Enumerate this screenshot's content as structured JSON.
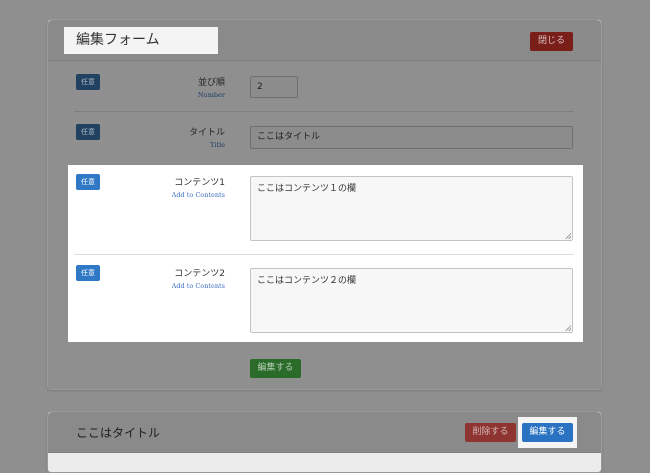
{
  "form": {
    "title": "編集フォーム",
    "close_label": "閉じる",
    "rows": [
      {
        "badge": "任意",
        "label": "並び順",
        "sublabel": "Number",
        "value": "2"
      },
      {
        "badge": "任意",
        "label": "タイトル",
        "sublabel": "Title",
        "value": "ここはタイトル"
      },
      {
        "badge": "任意",
        "label": "コンテンツ1",
        "sublabel": "Add to Contents",
        "value": "ここはコンテンツ１の欄"
      },
      {
        "badge": "任意",
        "label": "コンテンツ2",
        "sublabel": "Add to Contents",
        "value": "ここはコンテンツ２の欄"
      }
    ],
    "submit_label": "編集する"
  },
  "item": {
    "title": "ここはタイトル",
    "delete_label": "削除する",
    "edit_label": "編集する"
  },
  "colors": {
    "badge": "#2e78c5",
    "close": "#7a1e1a",
    "submit": "#2a6b2a",
    "edit": "#2a73c2"
  }
}
